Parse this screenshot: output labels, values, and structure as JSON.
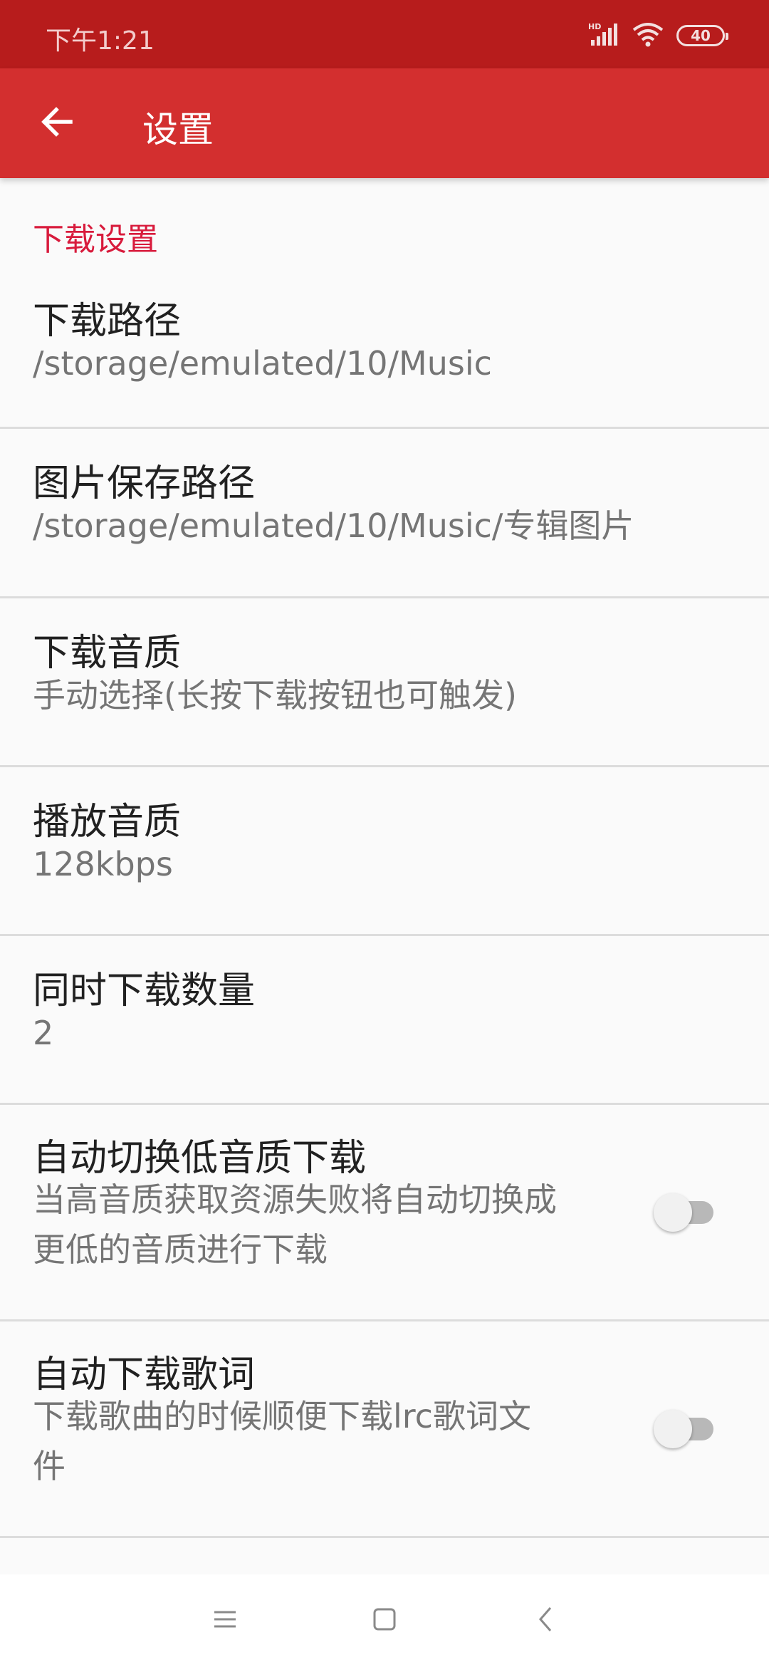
{
  "status_bar": {
    "time": "下午1:21",
    "battery": "40",
    "icons": [
      "hd-signal-icon",
      "wifi-icon",
      "battery-icon"
    ]
  },
  "app_bar": {
    "title": "设置",
    "back_icon": "arrow-left-icon",
    "color": "#d32f2f"
  },
  "section": {
    "title": "下载设置",
    "color": "#d81b3c"
  },
  "prefs": [
    {
      "title": "下载路径",
      "summary": "/storage/emulated/10/Music"
    },
    {
      "title": "图片保存路径",
      "summary": "/storage/emulated/10/Music/专辑图片"
    },
    {
      "title": "下载音质",
      "summary": "手动选择(长按下载按钮也可触发)"
    },
    {
      "title": "播放音质",
      "summary": "128kbps"
    },
    {
      "title": "同时下载数量",
      "summary": "2"
    },
    {
      "title": "自动切换低音质下载",
      "summary_lines": [
        "当高音质获取资源失败将自动切换成",
        "更低的音质进行下载"
      ],
      "switch_on": false
    },
    {
      "title": "自动下载歌词",
      "summary_lines": [
        "下载歌曲的时候顺便下载lrc歌词文",
        "件"
      ],
      "switch_on": false
    }
  ],
  "nav_bar": {
    "icons": [
      "menu-icon",
      "home-square-icon",
      "back-chevron-icon"
    ]
  }
}
